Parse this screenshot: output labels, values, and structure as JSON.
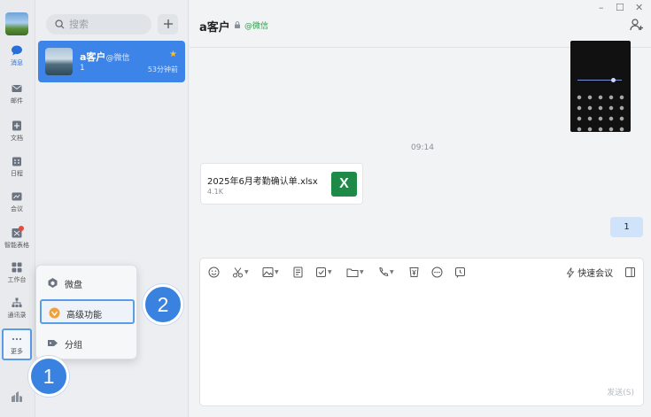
{
  "rail": {
    "items": [
      {
        "label": "消息",
        "icon": "chat-bubble-icon"
      },
      {
        "label": "邮件",
        "icon": "mail-icon"
      },
      {
        "label": "文档",
        "icon": "document-icon"
      },
      {
        "label": "日程",
        "icon": "calendar-icon"
      },
      {
        "label": "会议",
        "icon": "meeting-icon"
      },
      {
        "label": "智能表格",
        "icon": "smart-table-icon"
      },
      {
        "label": "工作台",
        "icon": "workbench-icon"
      },
      {
        "label": "通讯录",
        "icon": "contacts-icon"
      },
      {
        "label": "更多",
        "icon": "more-dots-icon"
      }
    ]
  },
  "search": {
    "placeholder": "搜索"
  },
  "conversation": {
    "name": "a客户",
    "source": "@微信",
    "last_message": "1",
    "time": "53分钟前"
  },
  "popup_menu": {
    "items": [
      {
        "label": "微盘"
      },
      {
        "label": "高级功能"
      },
      {
        "label": "分组"
      }
    ]
  },
  "callouts": {
    "one": "1",
    "two": "2"
  },
  "chat": {
    "title": "a客户",
    "source": "@微信",
    "window_controls": {
      "minimize": "–",
      "maximize": "☐",
      "close": "✕"
    },
    "timestamp": "09:14",
    "file": {
      "name": "2025年6月考勤确认单.xlsx",
      "size": "4.1K",
      "badge": "X"
    },
    "my_message": "1"
  },
  "composer": {
    "quick_meeting": "快速会议",
    "send": "发送(S)"
  },
  "colors": {
    "accent": "#3d84e8",
    "wechat_green": "#2ba245",
    "excel_green": "#1f8a47",
    "callout": "#3a82e0"
  }
}
